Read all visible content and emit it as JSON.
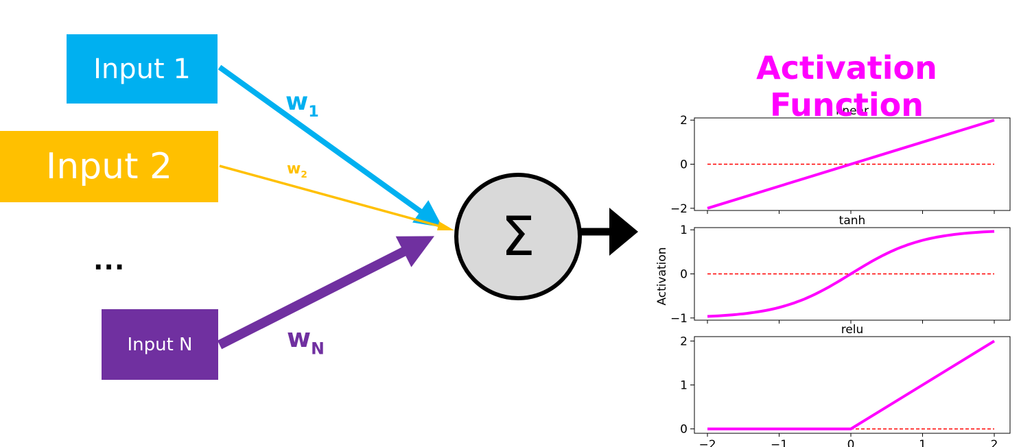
{
  "colors": {
    "input1": "#00b0f0",
    "input2": "#ffc000",
    "inputN": "#7030a0",
    "activation": "#ff00ff",
    "baseline": "#ff0000",
    "node_fill": "#d9d9d9"
  },
  "inputs": {
    "input1": "Input 1",
    "input2": "Input 2",
    "ellipsis": "...",
    "inputN": "Input N"
  },
  "weights": {
    "w1": {
      "base": "w",
      "sub": "1"
    },
    "w2": {
      "base": "w",
      "sub": "2"
    },
    "wN": {
      "base": "w",
      "sub": "N"
    }
  },
  "node": {
    "symbol": "Σ"
  },
  "activation_title": "Activation Function",
  "chart_data": [
    {
      "type": "line",
      "title": "linear",
      "ylabel": "Activation",
      "x": [
        -2,
        2
      ],
      "y": [
        -2,
        2
      ],
      "xlim": [
        -2,
        2
      ],
      "ylim": [
        -2.1,
        2.1
      ],
      "yticks": [
        "2",
        "0",
        "−2"
      ],
      "yticks_values": [
        2,
        0,
        -2
      ],
      "baseline": 0
    },
    {
      "type": "line",
      "title": "tanh",
      "x": [
        -2,
        -1.5,
        -1,
        -0.5,
        0,
        0.5,
        1,
        1.5,
        2
      ],
      "y": [
        -0.964,
        -0.905,
        -0.762,
        -0.462,
        0,
        0.462,
        0.762,
        0.905,
        0.964
      ],
      "xlim": [
        -2,
        2
      ],
      "ylim": [
        -1.05,
        1.05
      ],
      "yticks": [
        "1",
        "0",
        "−1"
      ],
      "yticks_values": [
        1,
        0,
        -1
      ],
      "baseline": 0
    },
    {
      "type": "line",
      "title": "relu",
      "x": [
        -2,
        0,
        2
      ],
      "y": [
        0,
        0,
        2
      ],
      "xlim": [
        -2,
        2
      ],
      "ylim": [
        -0.1,
        2.1
      ],
      "yticks": [
        "2",
        "1",
        "0"
      ],
      "yticks_values": [
        2,
        1,
        0
      ],
      "xticks": [
        "−2",
        "−1",
        "0",
        "1",
        "2"
      ],
      "xticks_values": [
        -2,
        -1,
        0,
        1,
        2
      ],
      "baseline": 0
    }
  ]
}
